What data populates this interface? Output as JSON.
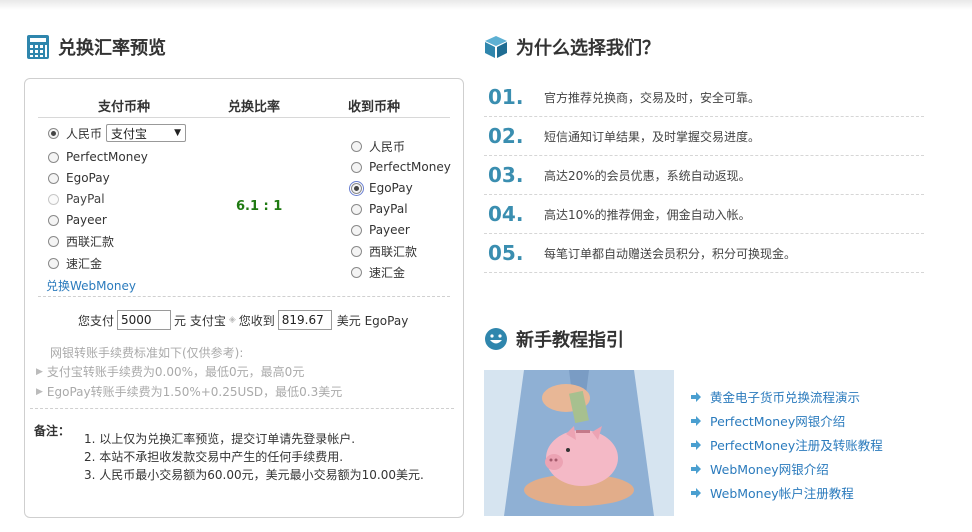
{
  "left": {
    "title": "兑换汇率预览",
    "headers": {
      "pay": "支付币种",
      "rate": "兑换比率",
      "receive": "收到币种"
    },
    "pay_options": [
      {
        "label": "人民币",
        "checked": true,
        "disabled": false
      },
      {
        "label": "PerfectMoney",
        "checked": false,
        "disabled": false
      },
      {
        "label": "EgoPay",
        "checked": false,
        "disabled": false
      },
      {
        "label": "PayPal",
        "checked": false,
        "disabled": true
      },
      {
        "label": "Payeer",
        "checked": false,
        "disabled": false
      },
      {
        "label": "西联汇款",
        "checked": false,
        "disabled": false
      },
      {
        "label": "速汇金",
        "checked": false,
        "disabled": false
      }
    ],
    "pay_method_select": "支付宝",
    "receive_options": [
      {
        "label": "人民币",
        "checked": false
      },
      {
        "label": "PerfectMoney",
        "checked": false
      },
      {
        "label": "EgoPay",
        "checked": true
      },
      {
        "label": "PayPal",
        "checked": false
      },
      {
        "label": "Payeer",
        "checked": false
      },
      {
        "label": "西联汇款",
        "checked": false
      },
      {
        "label": "速汇金",
        "checked": false
      }
    ],
    "rate_value": "6.1 : 1",
    "webmoney_link": "兑换WebMoney",
    "calc": {
      "pay_prefix": "您支付",
      "pay_amount": "5000",
      "pay_unit": "元 支付宝",
      "receive_prefix": "您收到",
      "receive_amount": "819.67",
      "receive_unit": "美元 EgoPay"
    },
    "fees": {
      "heading": "网银转账手续费标准如下(仅供参考):",
      "line1": "支付宝转账手续费为0.00%，最低0元，最高0元",
      "line2": "EgoPay转账手续费为1.50%+0.25USD，最低0.3美元"
    },
    "notes": {
      "label": "备注：",
      "items": [
        "1.  以上仅为兑换汇率预览，提交订单请先登录帐户.",
        "2.  本站不承担收发款交易中产生的任何手续费用.",
        "3.  人民币最小交易额为60.00元，美元最小交易额为10.00美元."
      ]
    }
  },
  "why": {
    "title": "为什么选择我们？",
    "items": [
      {
        "num": "01.",
        "text": "官方推荐兑换商，交易及时，安全可靠。"
      },
      {
        "num": "02.",
        "text": "短信通知订单结果，及时掌握交易进度。"
      },
      {
        "num": "03.",
        "text": "高达20%的会员优惠，系统自动返现。"
      },
      {
        "num": "04.",
        "text": "高达10%的推荐佣金，佣金自动入帐。"
      },
      {
        "num": "05.",
        "text": "每笔订单都自动赠送会员积分，积分可换现金。"
      }
    ]
  },
  "guide": {
    "title": "新手教程指引",
    "links": [
      "黄金电子货币兑换流程演示",
      "PerfectMoney网银介绍",
      "PerfectMoney注册及转账教程",
      "WebMoney网银介绍",
      "WebMoney帐户注册教程"
    ]
  },
  "colors": {
    "accent": "#3a8eb0",
    "link": "#2b7bbd",
    "rate": "#1f7a12"
  },
  "icons": {
    "calculator": "calculator-icon",
    "cube": "cube-icon",
    "smiley": "smiley-icon",
    "arrow": "arrow-right-icon"
  }
}
